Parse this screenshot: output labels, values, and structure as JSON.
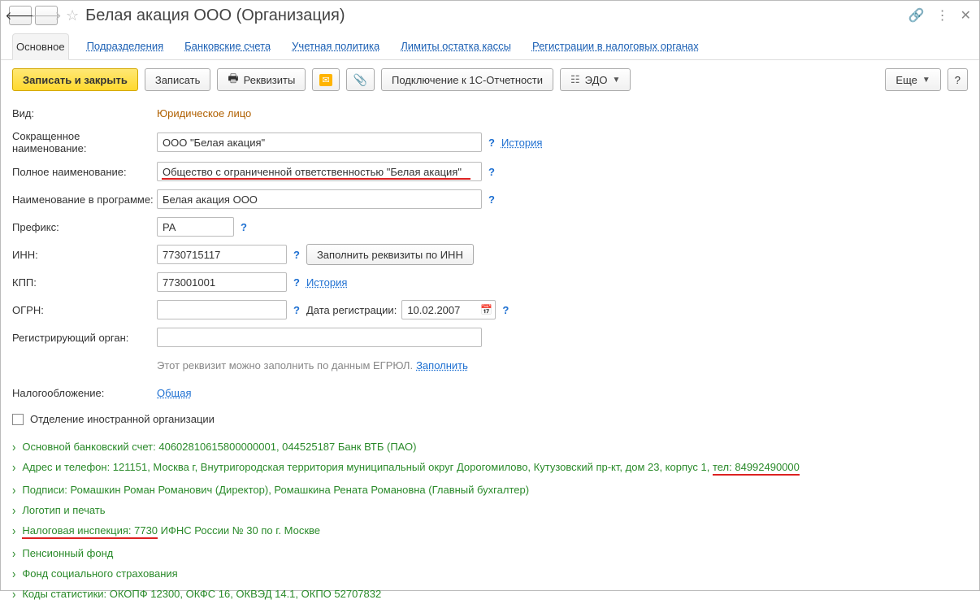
{
  "title": "Белая акация ООО (Организация)",
  "tabs": {
    "main": "Основное",
    "divisions": "Подразделения",
    "bank": "Банковские счета",
    "policy": "Учетная политика",
    "limits": "Лимиты остатка кассы",
    "tax_reg": "Регистрации в налоговых органах"
  },
  "toolbar": {
    "save_close": "Записать и закрыть",
    "save": "Записать",
    "requisites": "Реквизиты",
    "connect": "Подключение к 1С-Отчетности",
    "edo": "ЭДО",
    "more": "Еще",
    "help": "?"
  },
  "form": {
    "kind_label": "Вид:",
    "kind_value": "Юридическое лицо",
    "short_name_label": "Сокращенное наименование:",
    "short_name_value": "ООО \"Белая акация\"",
    "history": "История",
    "full_name_label": "Полное наименование:",
    "full_name_value": "Общество с ограниченной ответственностью \"Белая акация\"",
    "prog_name_label": "Наименование в программе:",
    "prog_name_value": "Белая акация ООО",
    "prefix_label": "Префикс:",
    "prefix_value": "РА",
    "inn_label": "ИНН:",
    "inn_value": "7730715117",
    "fill_by_inn": "Заполнить реквизиты по ИНН",
    "kpp_label": "КПП:",
    "kpp_value": "773001001",
    "ogrn_label": "ОГРН:",
    "ogrn_value": "",
    "reg_date_label": "Дата регистрации:",
    "reg_date_value": "10.02.2007",
    "reg_org_label": "Регистрирующий орган:",
    "reg_org_value": "",
    "hint_egrul": "Этот реквизит можно заполнить по данным ЕГРЮЛ.",
    "fill": "Заполнить",
    "tax_label": "Налогообложение:",
    "tax_value": "Общая",
    "foreign_branch": "Отделение иностранной организации"
  },
  "accordion": {
    "bank": "Основной банковский счет: 40602810615800000001, 044525187 Банк ВТБ (ПАО)",
    "addr_prefix": "Адрес и телефон: 121151, Москва г, Внутригородская территория муниципальный округ Дорогомилово, Кутузовский пр-кт, дом 23, корпус 1, ",
    "addr_tel": "тел: 84992490000",
    "sign": "Подписи: Ромашкин Роман Романович (Директор), Ромашкина Рената Романовна (Главный бухгалтер)",
    "logo": "Логотип и печать",
    "tax_insp_prefix": "Налоговая инспекция: 7730",
    "tax_insp_rest": " ИФНС России № 30 по г. Москве",
    "pension": "Пенсионный фонд",
    "social": "Фонд социального страхования",
    "stats": "Коды статистики: ОКОПФ 12300, ОКФС 16, ОКВЭД 14.1, ОКПО 52707832"
  }
}
